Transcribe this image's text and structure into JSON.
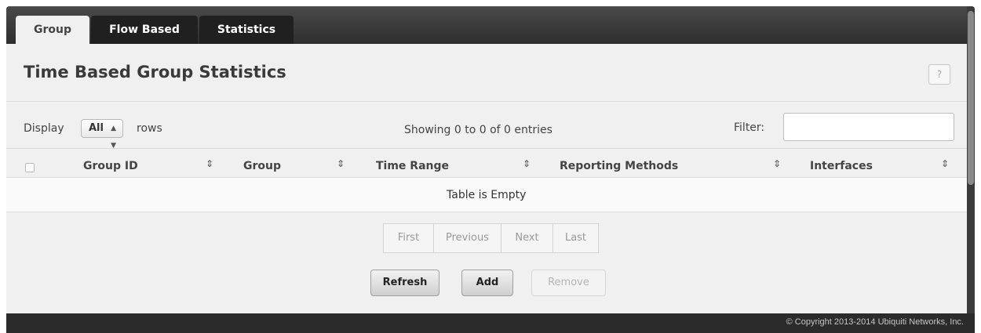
{
  "tabs": [
    {
      "label": "Group",
      "active": true
    },
    {
      "label": "Flow Based",
      "active": false
    },
    {
      "label": "Statistics",
      "active": false
    }
  ],
  "page": {
    "title": "Time Based Group Statistics",
    "help_label": "?"
  },
  "controls": {
    "display_label": "Display",
    "rows_value": "All",
    "rows_label": "rows",
    "showing_text": "Showing 0 to 0 of 0 entries",
    "filter_label": "Filter:",
    "filter_value": ""
  },
  "table": {
    "columns": [
      "Group ID",
      "Group",
      "Time Range",
      "Reporting Methods",
      "Interfaces"
    ],
    "empty_text": "Table is Empty"
  },
  "pagination": [
    "First",
    "Previous",
    "Next",
    "Last"
  ],
  "buttons": {
    "refresh": "Refresh",
    "add": "Add",
    "remove": "Remove"
  },
  "footer": {
    "copyright": "© Copyright 2013-2014 Ubiquiti Networks, Inc."
  }
}
